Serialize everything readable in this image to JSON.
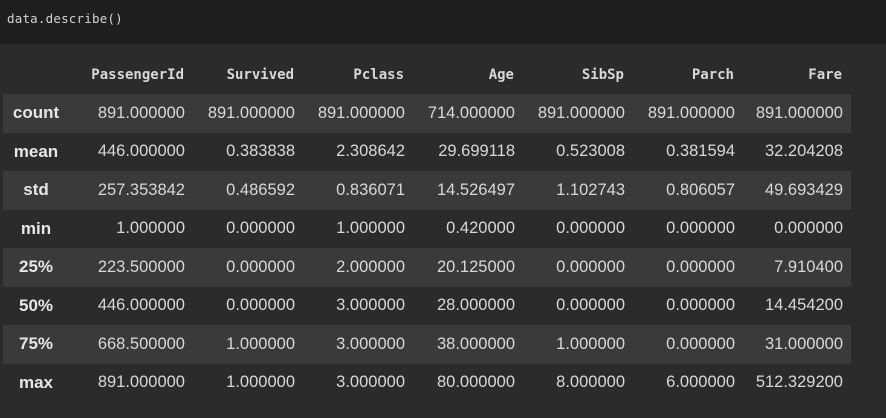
{
  "code_cell": {
    "source": "data.describe()"
  },
  "table": {
    "columns": [
      "PassengerId",
      "Survived",
      "Pclass",
      "Age",
      "SibSp",
      "Parch",
      "Fare"
    ],
    "rows": [
      {
        "index": "count",
        "values": [
          "891.000000",
          "891.000000",
          "891.000000",
          "714.000000",
          "891.000000",
          "891.000000",
          "891.000000"
        ]
      },
      {
        "index": "mean",
        "values": [
          "446.000000",
          "0.383838",
          "2.308642",
          "29.699118",
          "0.523008",
          "0.381594",
          "32.204208"
        ]
      },
      {
        "index": "std",
        "values": [
          "257.353842",
          "0.486592",
          "0.836071",
          "14.526497",
          "1.102743",
          "0.806057",
          "49.693429"
        ]
      },
      {
        "index": "min",
        "values": [
          "1.000000",
          "0.000000",
          "1.000000",
          "0.420000",
          "0.000000",
          "0.000000",
          "0.000000"
        ]
      },
      {
        "index": "25%",
        "values": [
          "223.500000",
          "0.000000",
          "2.000000",
          "20.125000",
          "0.000000",
          "0.000000",
          "7.910400"
        ]
      },
      {
        "index": "50%",
        "values": [
          "446.000000",
          "0.000000",
          "3.000000",
          "28.000000",
          "0.000000",
          "0.000000",
          "14.454200"
        ]
      },
      {
        "index": "75%",
        "values": [
          "668.500000",
          "1.000000",
          "3.000000",
          "38.000000",
          "1.000000",
          "0.000000",
          "31.000000"
        ]
      },
      {
        "index": "max",
        "values": [
          "891.000000",
          "1.000000",
          "3.000000",
          "80.000000",
          "8.000000",
          "6.000000",
          "512.329200"
        ]
      }
    ]
  },
  "colors": {
    "code_background": "#1e1e1e",
    "output_background": "#2b2b2b",
    "row_stripe": "#3a3a3a",
    "text": "#d8d8d8"
  }
}
